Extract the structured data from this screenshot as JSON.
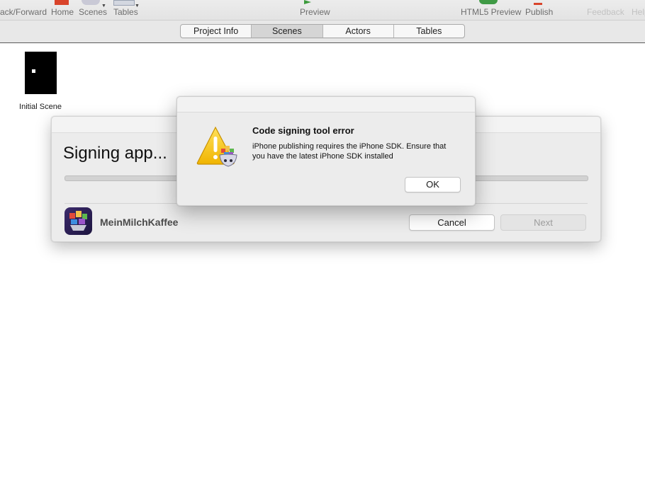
{
  "toolbar": {
    "back_forward": "ack/Forward",
    "home": "Home",
    "scenes": "Scenes",
    "tables": "Tables",
    "preview": "Preview",
    "html5_preview": "HTML5 Preview",
    "publish": "Publish",
    "feedback": "Feedback",
    "help": "Help"
  },
  "tabs": [
    {
      "label": "Project Info"
    },
    {
      "label": "Scenes"
    },
    {
      "label": "Actors"
    },
    {
      "label": "Tables"
    }
  ],
  "scene": {
    "label": "Initial Scene"
  },
  "signing_sheet": {
    "title": "Signing app...",
    "app_name": "MeinMilchKaffee",
    "cancel_label": "Cancel",
    "next_label": "Next"
  },
  "alert": {
    "title": "Code signing tool error",
    "message": "iPhone publishing requires the iPhone SDK. Ensure that you have the latest iPhone SDK installed",
    "ok_label": "OK",
    "icon": "warning-icon"
  },
  "colors": {
    "accent_toolbar_red": "#d9442b",
    "window_bg": "#ececec"
  }
}
